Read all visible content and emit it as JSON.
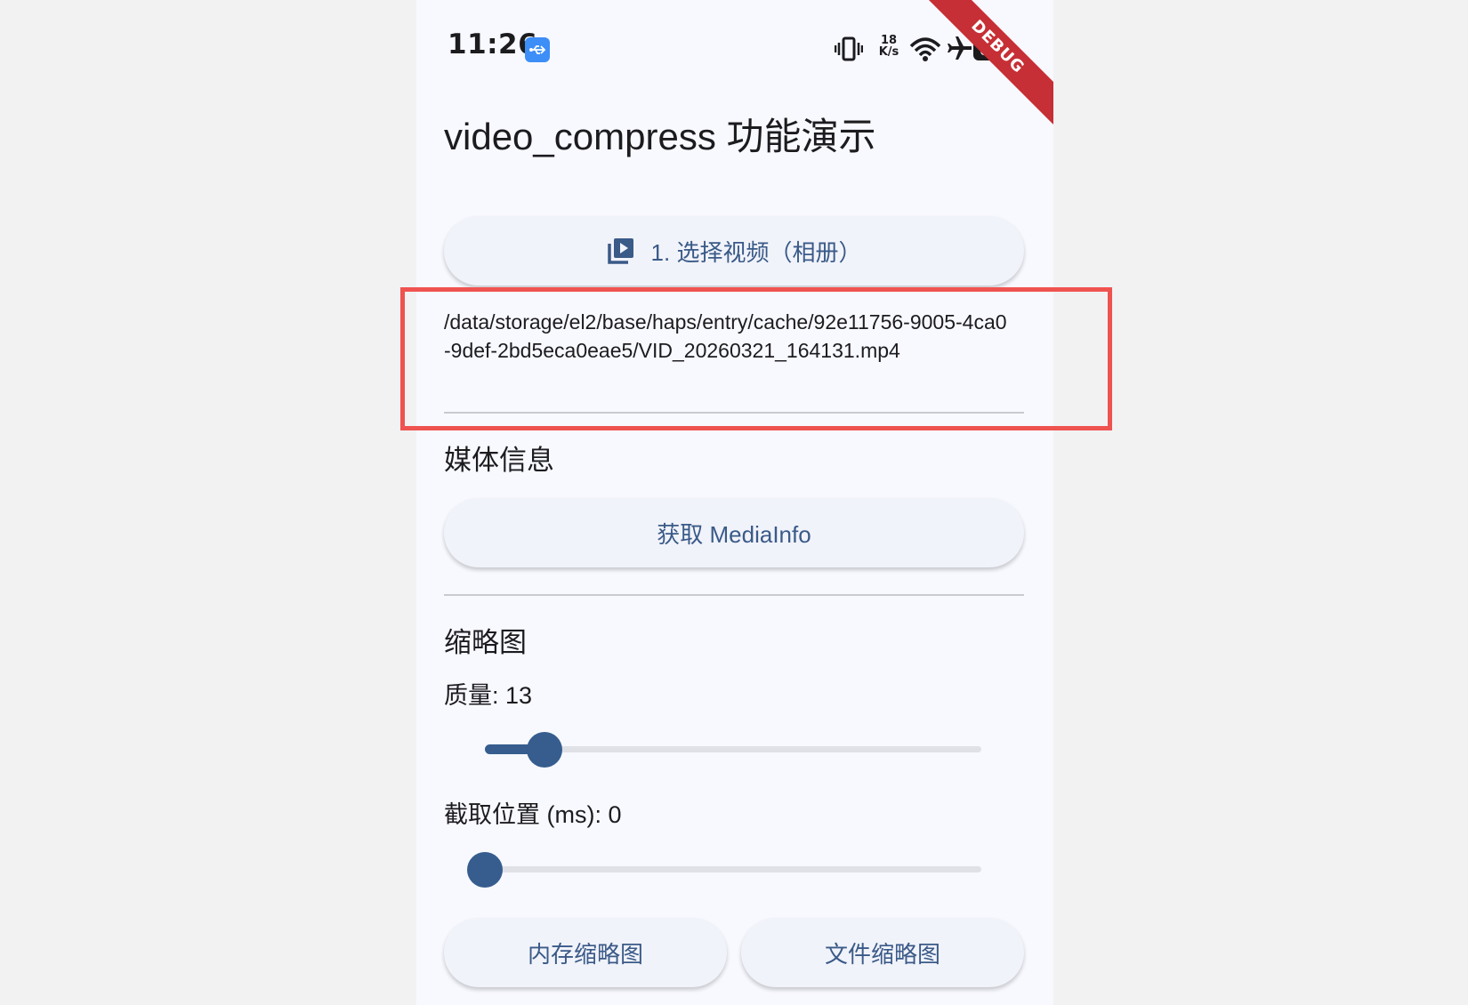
{
  "status_bar": {
    "time": "11:26",
    "net_speed_value": "18",
    "net_speed_unit": "K/s",
    "battery": "80",
    "usb_icon": "usb-debug-icon",
    "icons": [
      "vibrate-icon",
      "wifi-icon",
      "airplane-icon"
    ]
  },
  "debug_banner": "DEBUG",
  "app": {
    "title": "video_compress 功能演示",
    "pick_button_label": "1. 选择视频（相册）",
    "pick_button_icon": "video-library-icon",
    "selected_path": "/data/storage/el2/base/haps/entry/cache/92e11756-9005-4ca0-9def-2bd5eca0eae5/VID_20260321_164131.mp4",
    "media_section_title": "媒体信息",
    "media_button_label": "获取 MediaInfo",
    "thumb_section_title": "缩略图",
    "quality_label": "质量: 13",
    "quality_value": 13,
    "quality_fraction": 0.12,
    "position_label": "截取位置 (ms): 0",
    "position_value": 0,
    "position_fraction": 0.0,
    "memory_thumb_button": "内存缩略图",
    "file_thumb_button": "文件缩略图"
  },
  "colors": {
    "accent": "#365d8e",
    "button_text": "#3a5a88",
    "highlight": "#ef5350",
    "debug_ribbon": "#c62f35"
  }
}
